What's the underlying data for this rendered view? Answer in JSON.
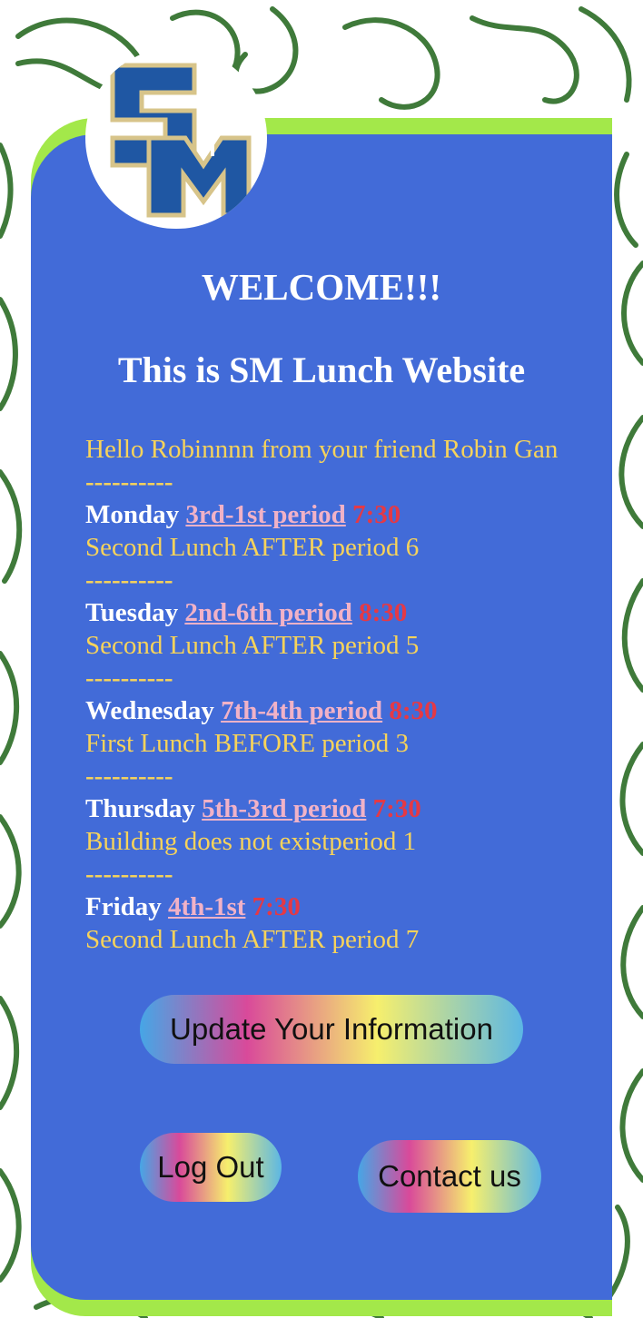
{
  "header": {
    "logo_text": "SM",
    "welcome": "WELCOME!!!",
    "site_title": "This is SM Lunch Website"
  },
  "greeting": "Hello Robinnnn from your friend Robin Gan",
  "separator": "----------",
  "schedule": [
    {
      "day": "Monday",
      "period": "3rd-1st period",
      "time": "7:30",
      "lunch": "Second Lunch AFTER period 6"
    },
    {
      "day": "Tuesday",
      "period": "2nd-6th period",
      "time": "8:30",
      "lunch": "Second Lunch AFTER period 5"
    },
    {
      "day": "Wednesday",
      "period": "7th-4th period",
      "time": "8:30",
      "lunch": "First Lunch BEFORE period 3"
    },
    {
      "day": "Thursday",
      "period": "5th-3rd period",
      "time": "7:30",
      "lunch": "Building does not existperiod 1"
    },
    {
      "day": "Friday",
      "period": "4th-1st",
      "time": "7:30",
      "lunch": "Second Lunch AFTER period 7"
    }
  ],
  "buttons": {
    "update": "Update Your Information",
    "logout": "Log Out",
    "contact": "Contact us"
  },
  "colors": {
    "card_background": "#426bd8",
    "card_accent": "#a3e84a",
    "greeting_text": "#f7d35a",
    "period_link": "#f1b2c7",
    "time_text": "#e53945",
    "doodle_stroke": "#3f7a3a"
  }
}
